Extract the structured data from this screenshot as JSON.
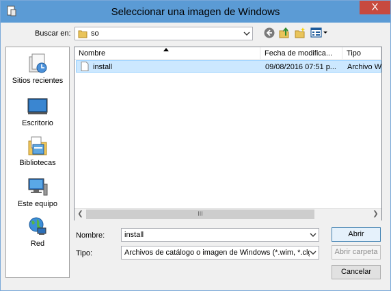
{
  "window": {
    "title": "Seleccionar una imagen de Windows",
    "close_label": "X"
  },
  "lookin": {
    "label": "Buscar en:",
    "value": "so"
  },
  "toolbar": {
    "back_icon": "back-icon",
    "up_icon": "up-folder-icon",
    "new_folder_icon": "new-folder-icon",
    "view_icon": "view-menu-icon"
  },
  "places": [
    {
      "label": "Sitios recientes",
      "icon": "recent-places-icon"
    },
    {
      "label": "Escritorio",
      "icon": "desktop-icon"
    },
    {
      "label": "Bibliotecas",
      "icon": "libraries-icon"
    },
    {
      "label": "Este equipo",
      "icon": "computer-icon"
    },
    {
      "label": "Red",
      "icon": "network-icon"
    }
  ],
  "columns": {
    "name": "Nombre",
    "date": "Fecha de modifica...",
    "type": "Tipo"
  },
  "files": [
    {
      "name": "install",
      "date": "09/08/2016 07:51 p...",
      "type": "Archivo W"
    }
  ],
  "filename": {
    "label": "Nombre:",
    "value": "install"
  },
  "filetype": {
    "label": "Tipo:",
    "value": "Archivos de catálogo o imagen de Windows (*.wim, *.clg)"
  },
  "buttons": {
    "open": "Abrir",
    "open_folder": "Abrir carpeta",
    "cancel": "Cancelar"
  },
  "scrollbar": {
    "grip": "III"
  },
  "colors": {
    "titlebar": "#5b9bd5",
    "close": "#c74a3f",
    "selection": "#cce8ff"
  }
}
